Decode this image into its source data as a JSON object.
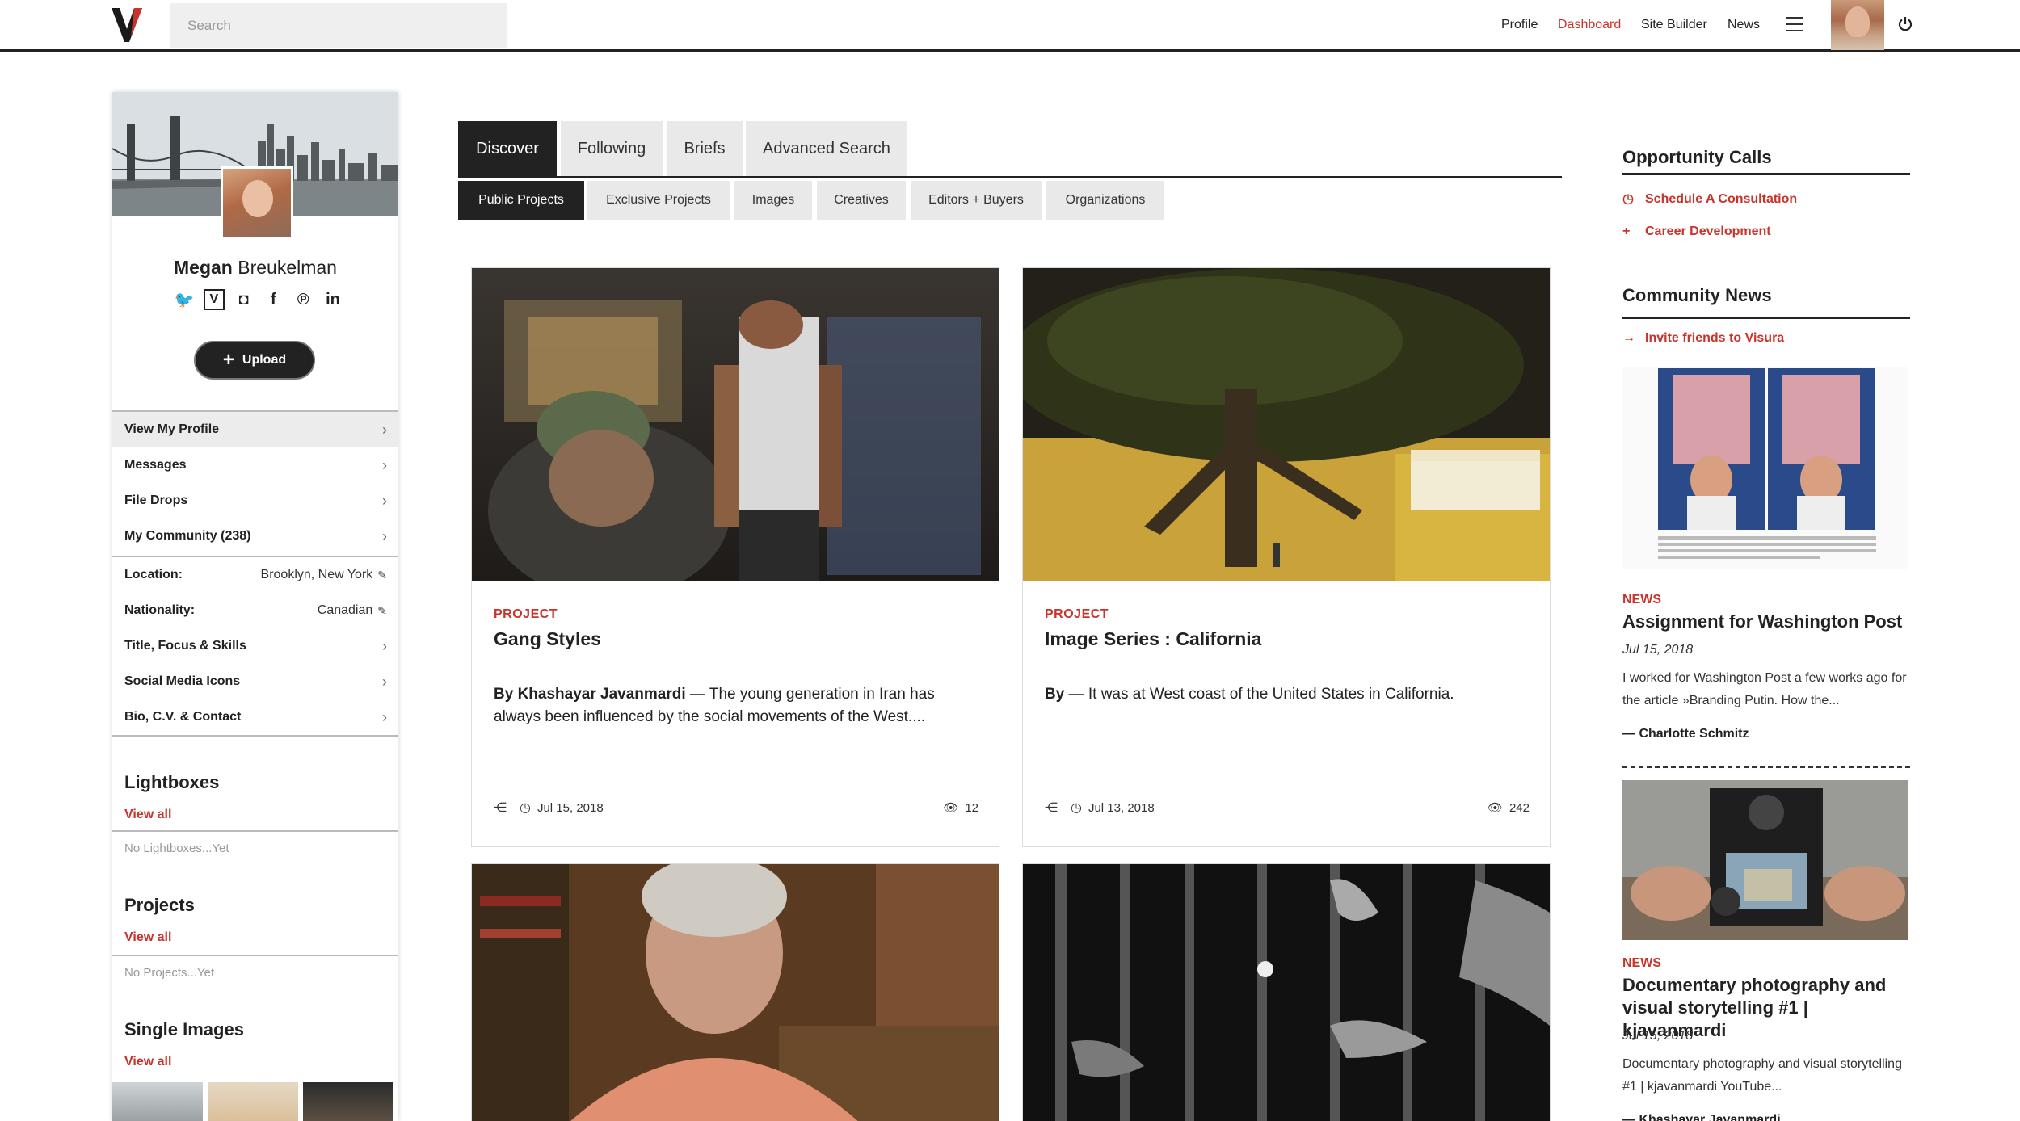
{
  "header": {
    "search_placeholder": "Search",
    "nav": [
      {
        "label": "Profile",
        "active": false
      },
      {
        "label": "Dashboard",
        "active": true
      },
      {
        "label": "Site Builder",
        "active": false
      },
      {
        "label": "News",
        "active": false
      }
    ],
    "accent_color": "#c8342b"
  },
  "sidebar": {
    "first_name": "Megan",
    "last_name": "Breukelman",
    "socials": [
      "twitter-icon",
      "visura-icon",
      "instagram-icon",
      "facebook-icon",
      "pinterest-icon",
      "linkedin-icon"
    ],
    "upload_label": "Upload",
    "menu": [
      {
        "label": "View My Profile"
      },
      {
        "label": "Messages"
      },
      {
        "label": "File Drops"
      },
      {
        "label": "My Community (238)"
      }
    ],
    "details": [
      {
        "label": "Location:",
        "value": "Brooklyn, New York"
      },
      {
        "label": "Nationality:",
        "value": "Canadian"
      }
    ],
    "settings": [
      {
        "label": "Title, Focus & Skills"
      },
      {
        "label": "Social Media Icons"
      },
      {
        "label": "Bio, C.V. & Contact"
      }
    ],
    "lightboxes": {
      "title": "Lightboxes",
      "view_all": "View all",
      "empty": "No Lightboxes...Yet"
    },
    "projects": {
      "title": "Projects",
      "view_all": "View all",
      "empty": "No Projects...Yet"
    },
    "single_images": {
      "title": "Single Images",
      "view_all": "View all"
    }
  },
  "tabs": [
    "Discover",
    "Following",
    "Briefs",
    "Advanced Search"
  ],
  "subtabs": [
    "Public Projects",
    "Exclusive Projects",
    "Images",
    "Creatives",
    "Editors + Buyers",
    "Organizations"
  ],
  "cards": [
    {
      "tag": "PROJECT",
      "title": "Gang Styles",
      "author": "By Khashayar Javanmardi",
      "text": " — The young generation in Iran has always been influenced by the social movements of the West....",
      "date": "Jul 15, 2018",
      "views": "12"
    },
    {
      "tag": "PROJECT",
      "title": "Image Series : California",
      "author": "By",
      "text": " — It was at West coast of the United States in California.",
      "date": "Jul 13, 2018",
      "views": "242"
    }
  ],
  "right": {
    "opportunity_title": "Opportunity Calls",
    "opportunity_links": [
      "Schedule A Consultation",
      "Career Development"
    ],
    "community_title": "Community News",
    "invite_link": "Invite friends to Visura",
    "news": [
      {
        "tag": "NEWS",
        "title": "Assignment for Washington Post",
        "date": "Jul 15, 2018",
        "text": "I worked for Washington Post a few works ago for the article »Branding Putin. How the...",
        "author": "— Charlotte Schmitz"
      },
      {
        "tag": "NEWS",
        "title": "Documentary photography and visual storytelling #1 | kjavanmardi",
        "date": "Jul 15, 2018",
        "text": "Documentary photography and visual storytelling #1 | kjavanmardi YouTube...",
        "author": "— Khashayar Javanmardi"
      }
    ]
  }
}
